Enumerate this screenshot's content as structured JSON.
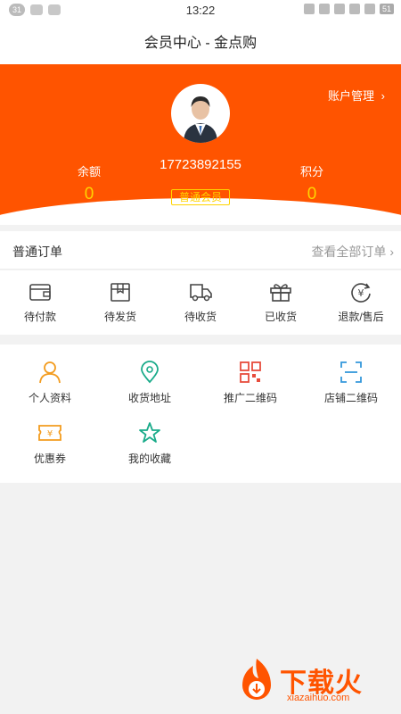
{
  "status_bar": {
    "notif_count": "31",
    "time": "13:22",
    "battery": "51"
  },
  "title": "会员中心 - 金点购",
  "profile": {
    "account_label": "账户管理",
    "phone": "17723892155",
    "member_level": "普通会员",
    "balance_label": "余额",
    "balance_value": "0",
    "points_label": "积分",
    "points_value": "0"
  },
  "orders": {
    "title": "普通订单",
    "view_all": "查看全部订单",
    "items": [
      {
        "label": "待付款",
        "icon": "wallet-icon"
      },
      {
        "label": "待发货",
        "icon": "box-icon"
      },
      {
        "label": "待收货",
        "icon": "truck-icon"
      },
      {
        "label": "已收货",
        "icon": "gift-icon"
      },
      {
        "label": "退款/售后",
        "icon": "refund-icon"
      }
    ]
  },
  "grid": {
    "items": [
      {
        "label": "个人资料",
        "icon": "person-icon",
        "color": "#f39c1f"
      },
      {
        "label": "收货地址",
        "icon": "location-icon",
        "color": "#1aab8a"
      },
      {
        "label": "推广二维码",
        "icon": "qrcode-icon",
        "color": "#e74c3c"
      },
      {
        "label": "店铺二维码",
        "icon": "scan-icon",
        "color": "#3498db"
      },
      {
        "label": "优惠券",
        "icon": "coupon-icon",
        "color": "#f39c1f"
      },
      {
        "label": "我的收藏",
        "icon": "star-icon",
        "color": "#1aab8a"
      }
    ]
  },
  "watermark": {
    "brand": "下载火",
    "site": "xiazaihuo.com"
  },
  "colors": {
    "brand": "#ff5400",
    "highlight": "#ffd400"
  }
}
